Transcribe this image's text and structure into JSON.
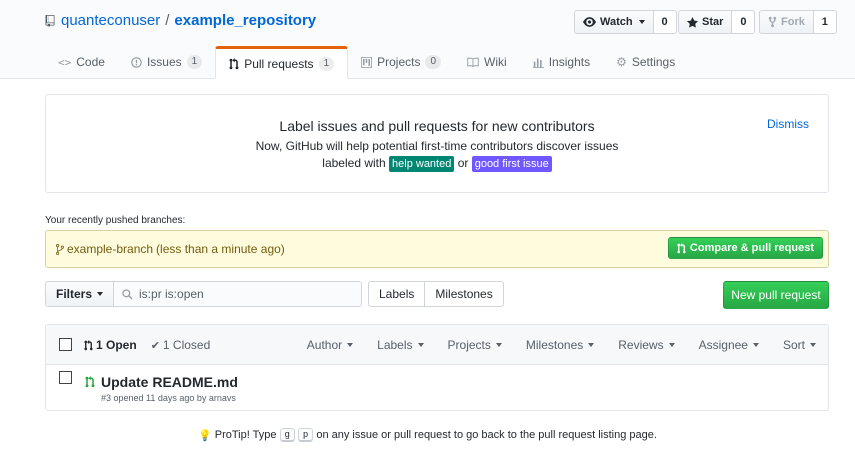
{
  "repo": {
    "owner": "quanteconuser",
    "separator": "/",
    "name": "example_repository"
  },
  "actions": {
    "watch": {
      "label": "Watch",
      "count": "0"
    },
    "star": {
      "label": "Star",
      "count": "0"
    },
    "fork": {
      "label": "Fork",
      "count": "1"
    }
  },
  "tabs": [
    {
      "label": "Code",
      "icon": "code-icon"
    },
    {
      "label": "Issues",
      "count": "1",
      "icon": "issue-icon"
    },
    {
      "label": "Pull requests",
      "count": "1",
      "icon": "pull-request-icon",
      "selected": true
    },
    {
      "label": "Projects",
      "count": "0",
      "icon": "project-icon"
    },
    {
      "label": "Wiki",
      "icon": "book-icon"
    },
    {
      "label": "Insights",
      "icon": "graph-icon"
    },
    {
      "label": "Settings",
      "icon": "gear-icon"
    }
  ],
  "onboarding": {
    "title": "Label issues and pull requests for new contributors",
    "line1": "Now, GitHub will help potential first-time contributors discover issues",
    "line2_prefix": "labeled with",
    "label_help": "help wanted",
    "label_or": "or",
    "label_first": "good first issue",
    "dismiss": "Dismiss",
    "colors": {
      "help": "#008672",
      "first": "#7057ff"
    }
  },
  "recent": {
    "heading": "Your recently pushed branches:",
    "branch": "example-branch",
    "time": "(less than a minute ago)",
    "compare_label": "Compare & pull request"
  },
  "filters": {
    "button": "Filters",
    "query": "is:pr is:open",
    "labels": "Labels",
    "milestones": "Milestones",
    "new_pr": "New pull request"
  },
  "list": {
    "open": "1 Open",
    "closed": "1 Closed",
    "sorts": [
      "Author",
      "Labels",
      "Projects",
      "Milestones",
      "Reviews",
      "Assignee",
      "Sort"
    ],
    "rows": [
      {
        "title": "Update README.md",
        "meta": "#3 opened 11 days ago by arnavs"
      }
    ]
  },
  "protip": {
    "prefix": "ProTip! Type",
    "key1": "g",
    "key2": "p",
    "suffix": "on any issue or pull request to go back to the pull request listing page."
  }
}
